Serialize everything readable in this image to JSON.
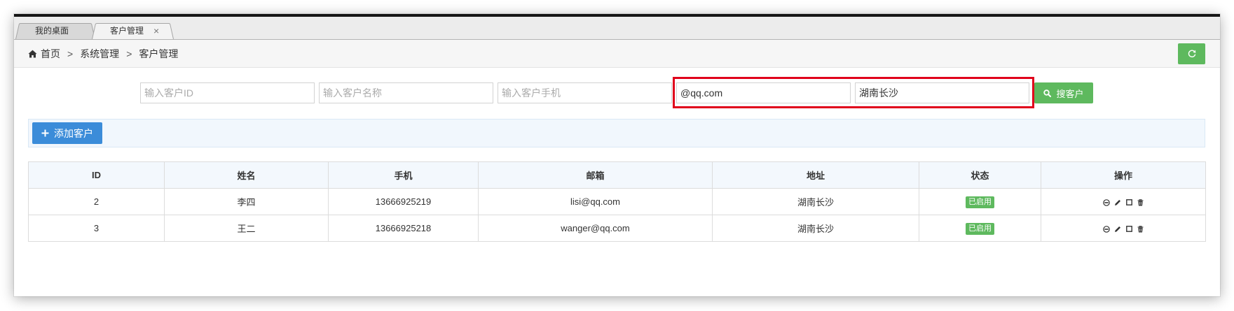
{
  "tabs": [
    {
      "label": "我的桌面"
    },
    {
      "label": "客户管理",
      "close": "×"
    }
  ],
  "breadcrumb": {
    "icon": "home-icon",
    "separator": ">",
    "items": [
      "首页",
      "系统管理",
      "客户管理"
    ]
  },
  "refresh_button": {
    "icon": "refresh-icon"
  },
  "search": {
    "fields": [
      {
        "placeholder": "输入客户ID"
      },
      {
        "placeholder": "输入客户名称"
      },
      {
        "placeholder": "输入客户手机"
      },
      {
        "value": "@qq.com"
      },
      {
        "value": "湖南长沙"
      }
    ],
    "button_icon": "search-icon",
    "button_label": "搜客户"
  },
  "toolbar": {
    "add_icon": "plus-icon",
    "add_label": "添加客户"
  },
  "table": {
    "columns": [
      "ID",
      "姓名",
      "手机",
      "邮箱",
      "地址",
      "状态",
      "操作"
    ],
    "rows": [
      {
        "id": "2",
        "name": "李四",
        "phone": "13666925219",
        "email": "lisi@qq.com",
        "address": "湖南长沙",
        "status": "已启用",
        "actions": [
          "disable-icon",
          "edit-icon",
          "square-icon",
          "delete-icon"
        ]
      },
      {
        "id": "3",
        "name": "王二",
        "phone": "13666925218",
        "email": "wanger@qq.com",
        "address": "湖南长沙",
        "status": "已启用",
        "actions": [
          "disable-icon",
          "edit-icon",
          "square-icon",
          "delete-icon"
        ]
      }
    ]
  },
  "colors": {
    "green": "#5eb95e",
    "blue": "#3b8cd9",
    "highlight_red": "#e0001b",
    "tab_active": "#f3f3f3",
    "tab_inactive": "#d8d8d8",
    "table_header": "#f3f8fd",
    "toolbar_bg": "#f1f7fd"
  }
}
